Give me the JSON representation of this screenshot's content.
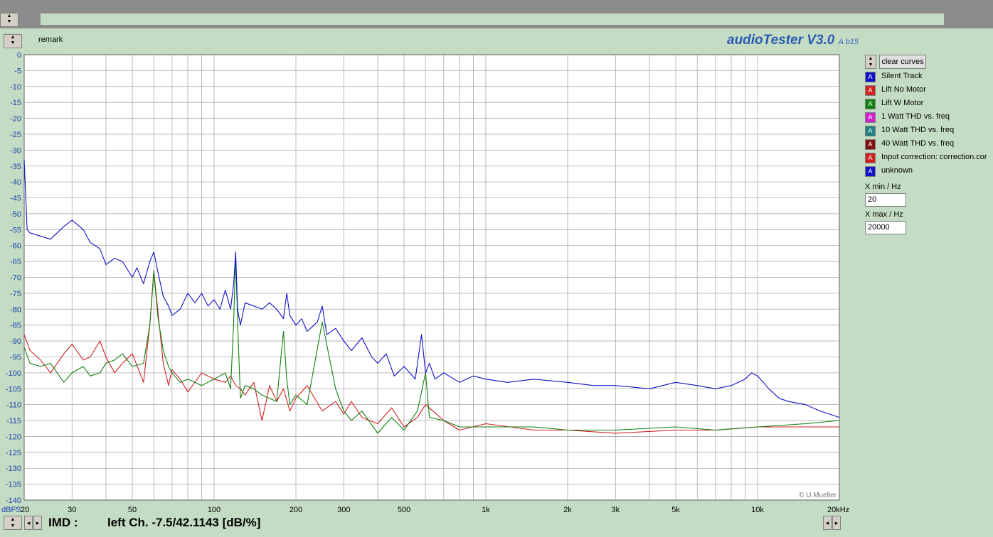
{
  "app": {
    "brand": "audioTester V3.0",
    "brand_suffix": "A b15",
    "remark_label": "remark"
  },
  "controls": {
    "clear_curves": "clear curves",
    "x_min_label": "X min / Hz",
    "x_min_value": "20",
    "x_max_label": "X max / Hz",
    "x_max_value": "20000"
  },
  "curves": [
    {
      "name": "Silent Track",
      "color": "#1010c8",
      "glyph": "A"
    },
    {
      "name": "Lift No Motor",
      "color": "#d02020",
      "glyph": "A"
    },
    {
      "name": "Lift W Motor",
      "color": "#108010",
      "glyph": "A"
    },
    {
      "name": "1 Watt THD vs. freq",
      "color": "#d020d0",
      "glyph": "A"
    },
    {
      "name": "10 Watt THD vs. freq",
      "color": "#208080",
      "glyph": "A"
    },
    {
      "name": "40 Watt THD vs. freq",
      "color": "#801010",
      "glyph": "A"
    },
    {
      "name": "Input correction: correction.cor",
      "color": "#d02020",
      "glyph": "A"
    },
    {
      "name": "unknown",
      "color": "#1010c8",
      "glyph": "A"
    }
  ],
  "status": {
    "imd_label": "IMD :",
    "imd_value": "left Ch. -7.5/42.1143 [dB/%]"
  },
  "chart_data": {
    "type": "line",
    "x_scale": "log",
    "xlim": [
      20,
      20000
    ],
    "ylim": [
      -140,
      0
    ],
    "ylabel": "dBFS",
    "x_ticks": [
      {
        "value": 20,
        "label": "20"
      },
      {
        "value": 30,
        "label": "30"
      },
      {
        "value": 50,
        "label": "50"
      },
      {
        "value": 100,
        "label": "100"
      },
      {
        "value": 200,
        "label": "200"
      },
      {
        "value": 300,
        "label": "300"
      },
      {
        "value": 500,
        "label": "500"
      },
      {
        "value": 1000,
        "label": "1k"
      },
      {
        "value": 2000,
        "label": "2k"
      },
      {
        "value": 3000,
        "label": "3k"
      },
      {
        "value": 5000,
        "label": "5k"
      },
      {
        "value": 10000,
        "label": "10k"
      },
      {
        "value": 20000,
        "label": "20kHz"
      }
    ],
    "y_ticks": [
      0,
      -5,
      -10,
      -15,
      -20,
      -25,
      -30,
      -35,
      -40,
      -45,
      -50,
      -55,
      -60,
      -65,
      -70,
      -75,
      -80,
      -85,
      -90,
      -95,
      -100,
      -105,
      -110,
      -115,
      -120,
      -125,
      -130,
      -135,
      -140
    ],
    "grid": true,
    "copyright": "© U.Mueller",
    "series": [
      {
        "name": "Silent Track",
        "color": "#1010c8",
        "x": [
          20,
          20.5,
          21,
          25,
          28,
          30,
          33,
          35,
          38,
          40,
          43,
          46,
          50,
          52,
          55,
          58,
          60,
          62,
          65,
          68,
          70,
          75,
          80,
          85,
          90,
          95,
          100,
          105,
          110,
          115,
          118,
          120,
          122,
          125,
          130,
          140,
          150,
          160,
          170,
          180,
          185,
          190,
          200,
          210,
          220,
          240,
          250,
          260,
          280,
          300,
          320,
          350,
          380,
          400,
          430,
          460,
          500,
          550,
          580,
          600,
          620,
          650,
          700,
          800,
          900,
          1000,
          1200,
          1500,
          2000,
          2500,
          3000,
          4000,
          5000,
          6000,
          7000,
          8000,
          9000,
          9500,
          10000,
          10500,
          11000,
          12000,
          13000,
          15000,
          17000,
          20000
        ],
        "y": [
          -33,
          -55,
          -56,
          -58,
          -54,
          -52,
          -55,
          -59,
          -61,
          -66,
          -64,
          -65,
          -70,
          -67,
          -72,
          -65,
          -62,
          -68,
          -76,
          -79,
          -82,
          -80,
          -75,
          -78,
          -75,
          -79,
          -77,
          -80,
          -74,
          -80,
          -72,
          -62,
          -80,
          -85,
          -78,
          -79,
          -80,
          -78,
          -80,
          -83,
          -75,
          -82,
          -85,
          -83,
          -87,
          -84,
          -79,
          -88,
          -86,
          -90,
          -93,
          -89,
          -95,
          -97,
          -94,
          -101,
          -98,
          -102,
          -88,
          -100,
          -97,
          -102,
          -100,
          -103,
          -101,
          -102,
          -103,
          -102,
          -103,
          -104,
          -104,
          -105,
          -103,
          -104,
          -105,
          -104,
          -102,
          -100,
          -101,
          -103,
          -105,
          -108,
          -109,
          -110,
          -112,
          -114
        ]
      },
      {
        "name": "Lift No Motor",
        "color": "#d02020",
        "x": [
          20,
          21,
          23,
          25,
          28,
          30,
          33,
          35,
          38,
          40,
          43,
          46,
          50,
          55,
          58,
          60,
          62,
          65,
          68,
          70,
          75,
          80,
          90,
          100,
          110,
          115,
          120,
          125,
          130,
          140,
          150,
          160,
          170,
          180,
          190,
          200,
          220,
          250,
          280,
          300,
          320,
          350,
          400,
          450,
          500,
          560,
          600,
          700,
          800,
          1000,
          1500,
          2000,
          3000,
          5000,
          7000,
          10000,
          15000,
          20000
        ],
        "y": [
          -88,
          -93,
          -96,
          -100,
          -94,
          -91,
          -96,
          -95,
          -90,
          -95,
          -100,
          -97,
          -94,
          -103,
          -85,
          -68,
          -80,
          -97,
          -104,
          -99,
          -102,
          -106,
          -100,
          -102,
          -103,
          -101,
          -104,
          -105,
          -107,
          -103,
          -115,
          -104,
          -109,
          -105,
          -112,
          -108,
          -104,
          -112,
          -109,
          -113,
          -109,
          -114,
          -116,
          -111,
          -117,
          -114,
          -110,
          -115,
          -118,
          -116,
          -118,
          -118,
          -119,
          -118,
          -118,
          -117,
          -117,
          -117
        ]
      },
      {
        "name": "Lift W Motor",
        "color": "#108010",
        "x": [
          20,
          21,
          23,
          25,
          28,
          30,
          33,
          35,
          38,
          40,
          43,
          46,
          50,
          55,
          58,
          60,
          62,
          65,
          68,
          70,
          75,
          80,
          90,
          100,
          110,
          115,
          118,
          120,
          122,
          125,
          130,
          140,
          150,
          170,
          180,
          185,
          190,
          200,
          220,
          250,
          280,
          300,
          320,
          350,
          400,
          450,
          500,
          560,
          600,
          620,
          700,
          800,
          1000,
          1500,
          2000,
          3000,
          5000,
          7000,
          10000,
          15000,
          20000
        ],
        "y": [
          -92,
          -97,
          -98,
          -97,
          -103,
          -100,
          -98,
          -101,
          -100,
          -97,
          -96,
          -94,
          -98,
          -97,
          -85,
          -68,
          -82,
          -93,
          -98,
          -100,
          -103,
          -102,
          -104,
          -102,
          -100,
          -105,
          -84,
          -63,
          -84,
          -108,
          -104,
          -105,
          -107,
          -109,
          -87,
          -102,
          -110,
          -107,
          -110,
          -84,
          -105,
          -112,
          -115,
          -112,
          -119,
          -114,
          -118,
          -112,
          -100,
          -114,
          -115,
          -117,
          -117,
          -117,
          -118,
          -118,
          -117,
          -118,
          -117,
          -116,
          -115
        ]
      }
    ]
  }
}
